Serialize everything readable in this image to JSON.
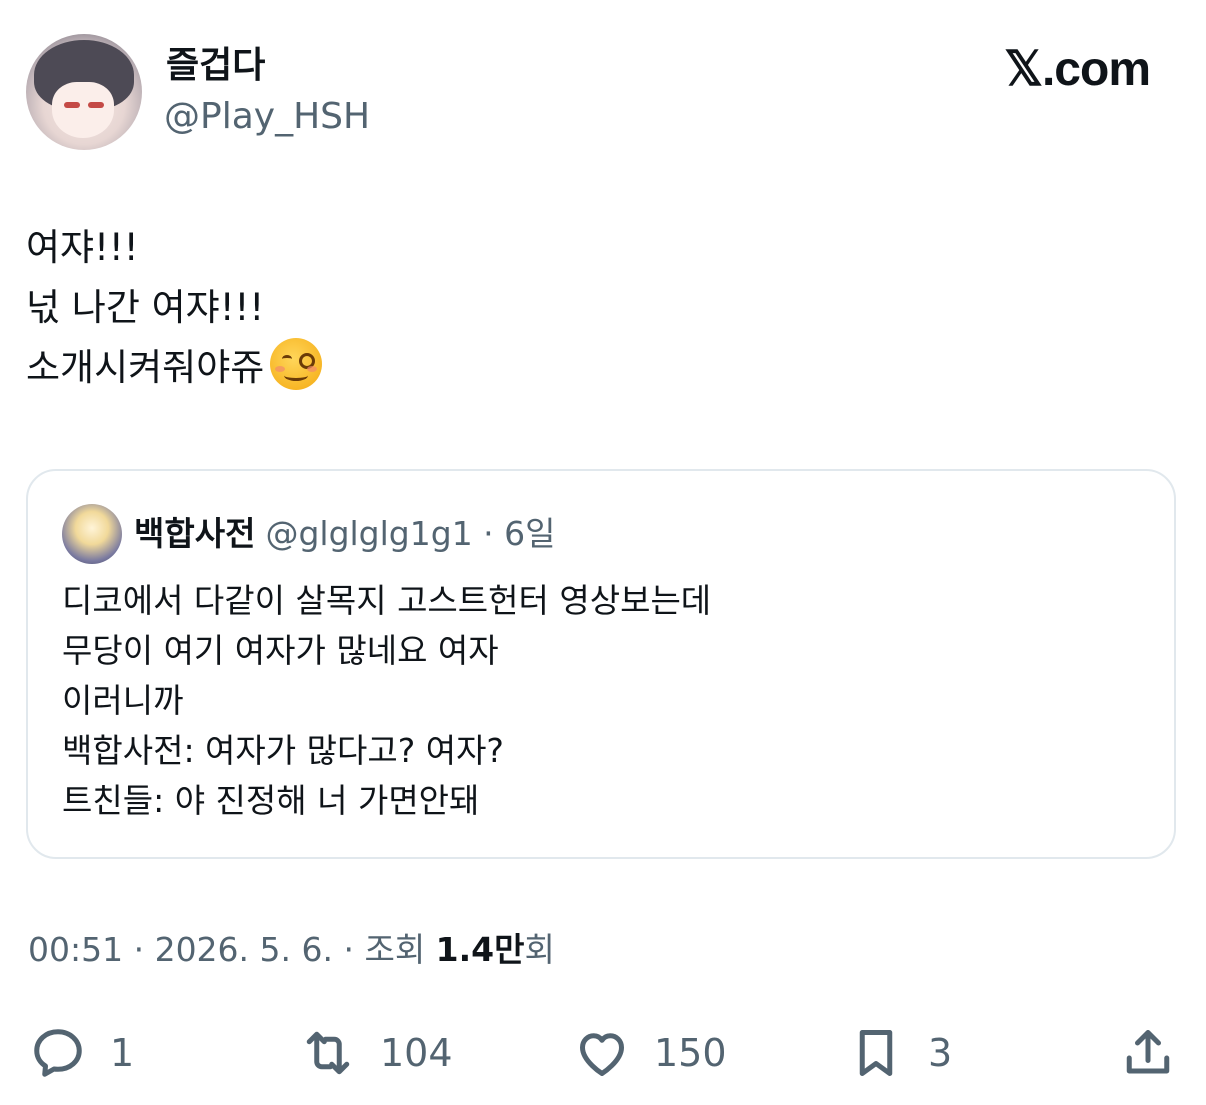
{
  "author": {
    "name": "즐겁다",
    "handle": "@Play_HSH"
  },
  "brand": "𝕏.com",
  "tweet": {
    "lines": [
      "여쟈!!!",
      "넋 나간 여쟈!!!",
      "소개시켜줘야쥬"
    ],
    "emoji": "woozy-face-emoji"
  },
  "quote": {
    "name": "백합사전",
    "meta": "@glglglg1g1 · 6일",
    "lines": [
      "디코에서 다같이 살목지 고스트헌터 영상보는데",
      "무당이 여기 여자가 많네요 여자",
      "이러니까",
      "백합사전: 여자가 많다고? 여자?",
      "트친들: 야 진정해 너 가면안돼"
    ]
  },
  "meta": {
    "time_date": "00:51 · 2026. 5. 6. · 조회 ",
    "views": "1.4만",
    "views_suffix": "회"
  },
  "actions": {
    "reply_count": "1",
    "retweet_count": "104",
    "like_count": "150",
    "bookmark_count": "3"
  },
  "colors": {
    "text": "#0f1419",
    "secondary": "#536471",
    "border": "#e1e8ed"
  }
}
